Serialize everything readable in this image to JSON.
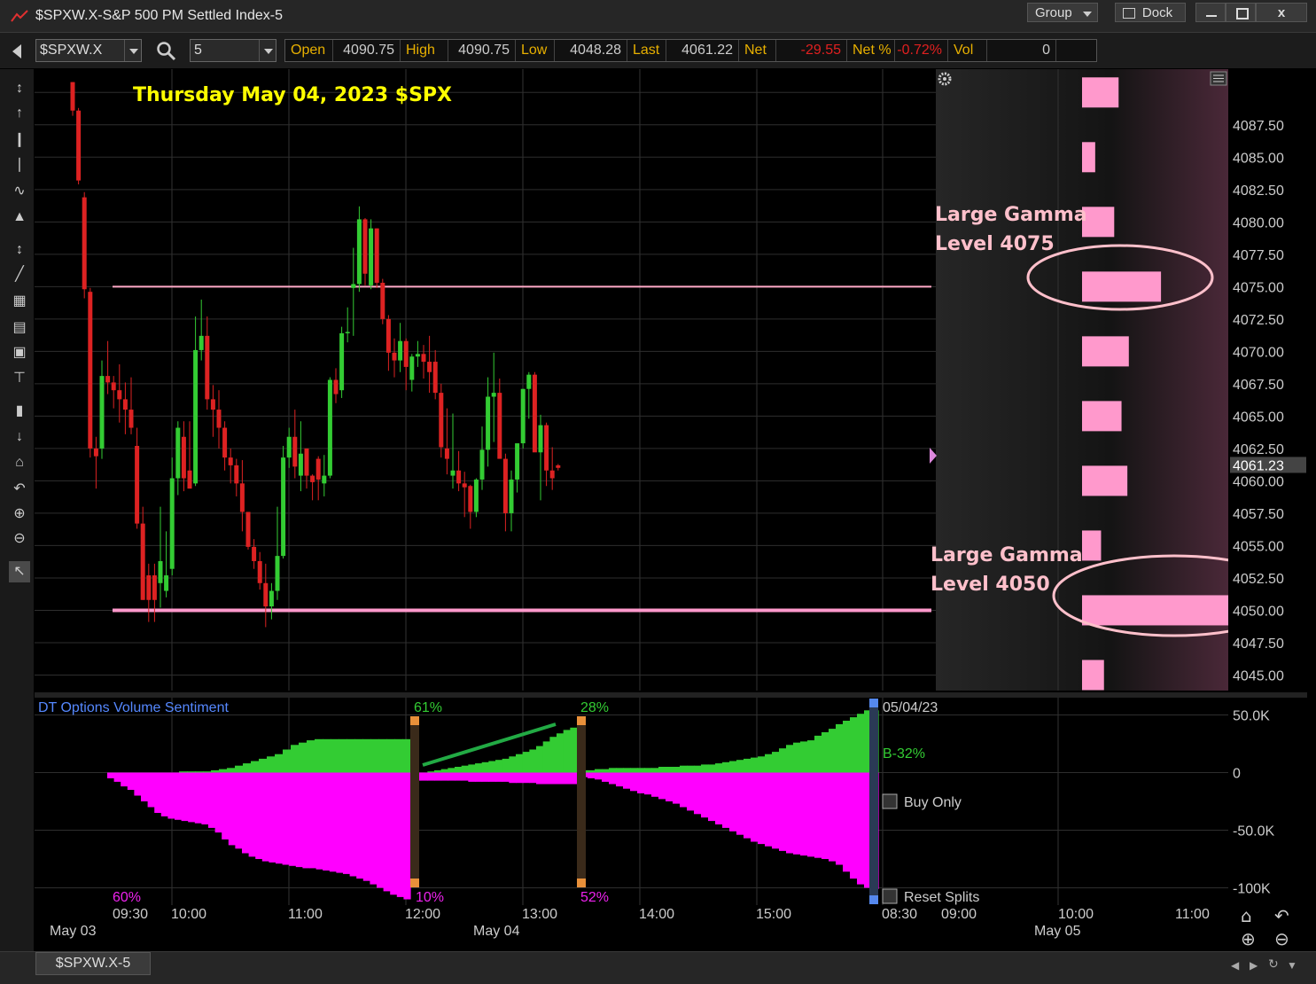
{
  "window": {
    "title": "$SPXW.X-S&P 500 PM Settled Index-5",
    "group_label": "Group",
    "dock_label": "Dock",
    "min_icon": "minimize-icon",
    "max_icon": "maximize-icon",
    "close_label": "x"
  },
  "toolbar": {
    "symbol": "$SPXW.X",
    "interval": "5",
    "quote": [
      {
        "label": "Open",
        "value": "4090.75",
        "neg": false
      },
      {
        "label": "High",
        "value": "4090.75",
        "neg": false
      },
      {
        "label": "Low",
        "value": "4048.28",
        "neg": false
      },
      {
        "label": "Last",
        "value": "4061.22",
        "neg": false
      },
      {
        "label": "Net",
        "value": "-29.55",
        "neg": true
      },
      {
        "label": "Net %",
        "value": "-0.72%",
        "neg": true
      },
      {
        "label": "Vol",
        "value": "0",
        "neg": false
      }
    ]
  },
  "annotations": {
    "heading": "Thursday May 04, 2023  $SPX",
    "gamma_upper_line1": "Large Gamma",
    "gamma_upper_line2": "Level 4075",
    "gamma_lower_line1": "Large Gamma",
    "gamma_lower_line2": "Level 4050"
  },
  "lower_panel": {
    "title": "DT Options Volume Sentiment",
    "date_label": "05/04/23",
    "b_label": "B-32%",
    "buy_only_label": "Buy Only",
    "reset_label": "Reset Splits",
    "pct_labels": [
      {
        "text": "61%",
        "color": "#33cc33",
        "pos": "top"
      },
      {
        "text": "28%",
        "color": "#33cc33",
        "pos": "top"
      },
      {
        "text": "60%",
        "color": "#ee22ee",
        "pos": "bottom"
      },
      {
        "text": "10%",
        "color": "#ee22ee",
        "pos": "bottom"
      },
      {
        "text": "52%",
        "color": "#ee22ee",
        "pos": "bottom"
      }
    ],
    "y_ticks": [
      "50.0K",
      "0",
      "-50.0K",
      "-100K"
    ]
  },
  "time_axis": {
    "time_labels": [
      "09:30",
      "10:00",
      "11:00",
      "12:00",
      "13:00",
      "14:00",
      "15:00",
      "08:30",
      "09:00",
      "10:00",
      "11:00"
    ],
    "date_labels": [
      "May 03",
      "May 04",
      "May 05"
    ]
  },
  "status": {
    "tab_label": "$SPXW.X-5"
  },
  "chart_data": [
    {
      "type": "candlestick",
      "y_ticks": [
        "4087.50",
        "4085.00",
        "4082.50",
        "4080.00",
        "4077.50",
        "4075.00",
        "4072.50",
        "4070.00",
        "4067.50",
        "4065.00",
        "4062.50",
        "4060.00",
        "4057.50",
        "4055.00",
        "4052.50",
        "4050.00",
        "4047.50",
        "4045.00"
      ],
      "ylim": [
        4043.8,
        4091.8
      ],
      "last_price": "4061.23",
      "levels": [
        {
          "value": 4075.0,
          "color": "#ffaac8"
        },
        {
          "value": 4050.0,
          "color": "#ff99cc"
        }
      ],
      "candles": [
        [
          4090.8,
          4090.8,
          4088.2,
          4088.6
        ],
        [
          4088.6,
          4088.8,
          4082.9,
          4083.2
        ],
        [
          4081.9,
          4082.3,
          4074.1,
          4074.8
        ],
        [
          4074.6,
          4074.9,
          4061.8,
          4062.5
        ],
        [
          4062.5,
          4063.4,
          4059.4,
          4061.9
        ],
        [
          4062.5,
          4069.3,
          4061.7,
          4068.1
        ],
        [
          4068.1,
          4070.8,
          4066.7,
          4067.6
        ],
        [
          4067.6,
          4068.1,
          4065.6,
          4067.0
        ],
        [
          4067.0,
          4069.0,
          4064.5,
          4066.3
        ],
        [
          4066.3,
          4067.6,
          4063.6,
          4065.5
        ],
        [
          4065.5,
          4068.0,
          4063.6,
          4064.1
        ],
        [
          4062.7,
          4064.1,
          4056.3,
          4056.7
        ],
        [
          4056.7,
          4058.0,
          4050.8,
          4050.8
        ],
        [
          4052.7,
          4053.6,
          4049.1,
          4050.8
        ],
        [
          4052.7,
          4053.6,
          4049.1,
          4050.8
        ],
        [
          4052.1,
          4058.0,
          4050.2,
          4053.8
        ],
        [
          4051.5,
          4056.1,
          4051.0,
          4052.7
        ],
        [
          4053.2,
          4061.8,
          4052.7,
          4060.2
        ],
        [
          4060.2,
          4064.6,
          4058.9,
          4064.1
        ],
        [
          4063.4,
          4064.6,
          4059.2,
          4060.2
        ],
        [
          4060.8,
          4064.6,
          4059.8,
          4059.4
        ],
        [
          4059.8,
          4072.7,
          4059.6,
          4070.1
        ],
        [
          4070.1,
          4074.0,
          4069.3,
          4071.2
        ],
        [
          4071.2,
          4072.7,
          4065.5,
          4066.3
        ],
        [
          4066.3,
          4067.4,
          4063.4,
          4065.5
        ],
        [
          4065.5,
          4067.0,
          4062.5,
          4064.1
        ],
        [
          4064.1,
          4064.6,
          4060.8,
          4061.8
        ],
        [
          4061.8,
          4062.5,
          4059.8,
          4061.2
        ],
        [
          4061.2,
          4061.7,
          4058.8,
          4059.8
        ],
        [
          4059.8,
          4061.6,
          4056.1,
          4057.6
        ],
        [
          4057.6,
          4057.6,
          4054.7,
          4054.9
        ],
        [
          4054.9,
          4055.5,
          4053.2,
          4053.8
        ],
        [
          4053.8,
          4054.5,
          4051.6,
          4052.1
        ],
        [
          4052.1,
          4053.6,
          4048.7,
          4050.3
        ],
        [
          4050.3,
          4052.1,
          4049.3,
          4051.5
        ],
        [
          4051.5,
          4058.0,
          4050.8,
          4054.2
        ],
        [
          4054.2,
          4062.7,
          4054.0,
          4061.8
        ],
        [
          4061.8,
          4064.1,
          4061.0,
          4063.4
        ],
        [
          4063.4,
          4065.5,
          4060.2,
          4061.1
        ],
        [
          4060.4,
          4064.6,
          4059.2,
          4062.1
        ],
        [
          4062.5,
          4062.5,
          4059.4,
          4060.4
        ],
        [
          4060.4,
          4060.5,
          4058.5,
          4059.9
        ],
        [
          4061.7,
          4061.9,
          4058.5,
          4060.1
        ],
        [
          4059.8,
          4062.0,
          4058.8,
          4060.4
        ],
        [
          4060.4,
          4068.0,
          4060.2,
          4067.8
        ],
        [
          4067.8,
          4068.7,
          4066.0,
          4066.7
        ],
        [
          4067.0,
          4071.9,
          4066.4,
          4071.4
        ],
        [
          4071.4,
          4073.4,
          4070.7,
          4071.5
        ],
        [
          4074.9,
          4078.0,
          4071.2,
          4075.2
        ],
        [
          4075.2,
          4081.2,
          4074.6,
          4080.2
        ],
        [
          4080.2,
          4080.3,
          4075.1,
          4076.0
        ],
        [
          4075.1,
          4080.2,
          4074.8,
          4079.5
        ],
        [
          4079.5,
          4079.5,
          4074.9,
          4075.3
        ],
        [
          4075.3,
          4075.6,
          4072.1,
          4072.5
        ],
        [
          4072.5,
          4072.8,
          4068.5,
          4069.9
        ],
        [
          4069.9,
          4071.0,
          4068.0,
          4069.3
        ],
        [
          4069.3,
          4072.2,
          4068.4,
          4070.8
        ],
        [
          4070.8,
          4071.0,
          4067.0,
          4068.8
        ],
        [
          4067.8,
          4069.8,
          4066.9,
          4069.6
        ],
        [
          4069.6,
          4070.8,
          4068.8,
          4069.8
        ],
        [
          4069.8,
          4070.5,
          4067.9,
          4069.2
        ],
        [
          4069.2,
          4071.2,
          4066.8,
          4068.4
        ],
        [
          4069.2,
          4070.1,
          4066.3,
          4066.8
        ],
        [
          4066.8,
          4067.5,
          4061.8,
          4062.6
        ],
        [
          4062.5,
          4065.6,
          4060.5,
          4061.7
        ],
        [
          4060.4,
          4065.2,
          4059.4,
          4060.8
        ],
        [
          4060.8,
          4062.3,
          4059.2,
          4059.8
        ],
        [
          4059.8,
          4060.7,
          4057.2,
          4059.5
        ],
        [
          4059.6,
          4059.7,
          4056.3,
          4057.6
        ],
        [
          4057.6,
          4060.2,
          4057.2,
          4060.1
        ],
        [
          4060.1,
          4064.2,
          4059.3,
          4062.4
        ],
        [
          4062.4,
          4068.0,
          4061.1,
          4066.5
        ],
        [
          4066.5,
          4069.9,
          4063.0,
          4066.8
        ],
        [
          4066.8,
          4067.9,
          4061.8,
          4061.7
        ],
        [
          4061.7,
          4062.1,
          4056.1,
          4057.5
        ],
        [
          4057.5,
          4060.8,
          4056.1,
          4060.1
        ],
        [
          4060.1,
          4061.7,
          4059.1,
          4062.9
        ],
        [
          4062.9,
          4067.1,
          4062.5,
          4067.1
        ],
        [
          4067.1,
          4068.4,
          4064.8,
          4068.2
        ],
        [
          4068.2,
          4068.4,
          4062.5,
          4062.2
        ],
        [
          4062.2,
          4065.1,
          4058.5,
          4064.3
        ],
        [
          4064.3,
          4064.5,
          4059.6,
          4060.8
        ],
        [
          4060.8,
          4062.6,
          4059.3,
          4060.2
        ],
        [
          4061.2,
          4061.3,
          4060.8,
          4061.0
        ]
      ],
      "gamma_profile": [
        {
          "level": 4090.0,
          "value": 0.25
        },
        {
          "level": 4085.0,
          "value": 0.09
        },
        {
          "level": 4080.0,
          "value": 0.22
        },
        {
          "level": 4075.0,
          "value": 0.54
        },
        {
          "level": 4070.0,
          "value": 0.32
        },
        {
          "level": 4065.0,
          "value": 0.27
        },
        {
          "level": 4060.0,
          "value": 0.31
        },
        {
          "level": 4055.0,
          "value": 0.13
        },
        {
          "level": 4050.0,
          "value": 1.0
        },
        {
          "level": 4045.0,
          "value": 0.15
        }
      ]
    },
    {
      "type": "area",
      "title": "DT Options Volume Sentiment",
      "ylim": [
        -115000,
        65000
      ],
      "y_ticks": [
        50000,
        0,
        -50000,
        -100000
      ],
      "series": [
        {
          "color": "#33cc33",
          "segments": [
            [
              0,
              0,
              0,
              0,
              0,
              0,
              0,
              0,
              0,
              1000,
              1000,
              1000,
              1000,
              2000,
              3000,
              4000,
              6000,
              8000,
              10000,
              12000,
              14000,
              16000,
              20000,
              24000,
              26000,
              28000,
              29000,
              29000,
              29000,
              29000,
              29000,
              29000,
              29000,
              29000,
              29000,
              29000,
              29000,
              29000
            ],
            [
              0,
              0,
              1000,
              2000,
              3000,
              4000,
              5000,
              6000,
              7000,
              8000,
              9000,
              10000,
              11000,
              12000,
              14000,
              16000,
              18000,
              20000,
              23000,
              27000,
              31000,
              34000,
              37000,
              39000
            ],
            [
              2000,
              2000,
              3000,
              3000,
              4000,
              4000,
              4000,
              4000,
              4000,
              4000,
              4000,
              5000,
              5000,
              5000,
              6000,
              6000,
              6000,
              7000,
              7000,
              8000,
              9000,
              10000,
              11000,
              12000,
              13000,
              14000,
              16000,
              18000,
              21000,
              24000,
              26000,
              27000,
              28000,
              32000,
              35000,
              38000,
              42000,
              45000,
              48000,
              51000,
              54000,
              54000
            ]
          ]
        },
        {
          "color": "#ff00ff",
          "segments": [
            [
              -5000,
              -8000,
              -12000,
              -15000,
              -20000,
              -25000,
              -30000,
              -35000,
              -38000,
              -40000,
              -41000,
              -42000,
              -43000,
              -44000,
              -45000,
              -48000,
              -52000,
              -58000,
              -63000,
              -66000,
              -70000,
              -73000,
              -75000,
              -77000,
              -78000,
              -79000,
              -80000,
              -81000,
              -82000,
              -83000,
              -83000,
              -84000,
              -85000,
              -86000,
              -87000,
              -88000,
              -90000,
              -92000,
              -94000,
              -97000,
              -100000,
              -103000,
              -106000,
              -108000,
              -110000
            ],
            [
              -7000,
              -7000,
              -7000,
              -7000,
              -7000,
              -7000,
              -7000,
              -7000,
              -8000,
              -8000,
              -8000,
              -8000,
              -8000,
              -8000,
              -9000,
              -9000,
              -9000,
              -9000,
              -10000,
              -10000,
              -10000,
              -10000,
              -10000,
              -10000
            ],
            [
              -4000,
              -5000,
              -6000,
              -8000,
              -10000,
              -12000,
              -14000,
              -16000,
              -18000,
              -19000,
              -21000,
              -23000,
              -25000,
              -27000,
              -30000,
              -33000,
              -36000,
              -39000,
              -42000,
              -45000,
              -48000,
              -51000,
              -54000,
              -57000,
              -60000,
              -62000,
              -64000,
              -66000,
              -68000,
              -70000,
              -71000,
              -72000,
              -73000,
              -74000,
              -75000,
              -77000,
              -80000,
              -86000,
              -92000,
              -97000,
              -100000,
              -101000
            ]
          ]
        }
      ]
    }
  ]
}
